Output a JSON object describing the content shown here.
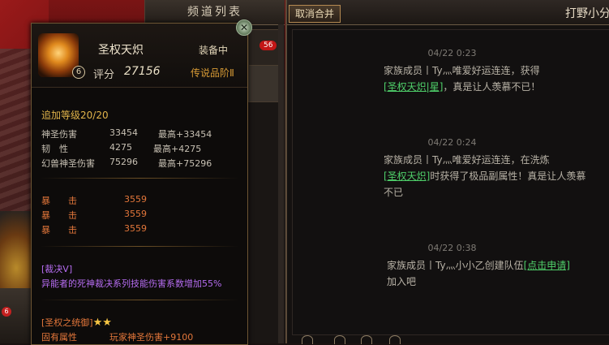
{
  "channel_list": {
    "title": "频道列表",
    "unread_count": "56"
  },
  "chat": {
    "cancel_merge_label": "取消合并",
    "title": "打野小分",
    "messages": [
      {
        "time": "04/22 0:23",
        "prefix": "家族成员丨Ty灬唯爱好运连连，获得",
        "link": "[圣权天炽|星]",
        "suffix": "，真是让人羡慕不已！"
      },
      {
        "time": "04/22 0:24",
        "prefix": "家族成员丨Ty灬唯爱好运连连，在洗炼",
        "link": "[圣权天炽]",
        "suffix": "时获得了极品副属性！真是让人羡慕不已"
      },
      {
        "time": "04/22 0:38",
        "prefix": "家族成员丨Ty灬小小乙创建队伍",
        "link": "[点击申请]",
        "suffix": "加入吧"
      }
    ]
  },
  "tooltip": {
    "item_name": "圣权天炽",
    "equipped_label": "装备中",
    "level_badge": "6",
    "score_label": "评分",
    "score_value": "27156",
    "grade": "传说品阶Ⅱ",
    "enhance_level": "追加等级20/20",
    "base_stats": [
      {
        "name": "神圣伤害",
        "value": "33454",
        "max": "最高+33454"
      },
      {
        "name": "韧　性",
        "value": "4275",
        "max": "最高+4275"
      },
      {
        "name": "幻兽神圣伤害",
        "value": "75296",
        "max": "最高+75296"
      }
    ],
    "extra_stats": [
      {
        "name": "暴　　击",
        "value": "3559"
      },
      {
        "name": "暴　　击",
        "value": "3559"
      },
      {
        "name": "暴　　击",
        "value": "3559"
      }
    ],
    "skill_title": "[裁决Ⅴ]",
    "skill_desc": "异能者的死神裁决系列技能伤害系数增加55%",
    "set_title": "[圣权之统御]",
    "set_stars": "★★",
    "inherent_label": "固有属性",
    "inherent_value": "玩家神圣伤害+9100"
  },
  "side": {
    "avatar_badge": "6"
  },
  "colors": {
    "gold_text": "#e0b34a",
    "stat_orange": "#e2763a",
    "skill_purple": "#b56cf0",
    "link_green": "#4fd06a",
    "unread_red": "#c31616"
  }
}
